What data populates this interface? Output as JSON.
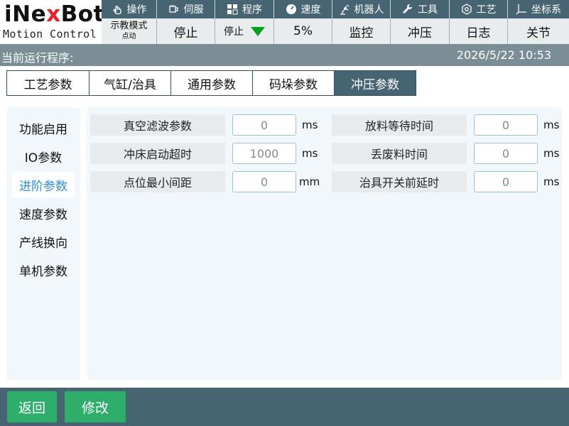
{
  "logo": {
    "brand": [
      "i",
      "Ne",
      "x",
      "Bot"
    ],
    "tagline": "Motion Control"
  },
  "topnav": [
    {
      "label": "操作",
      "icon": "hand-pointer-icon"
    },
    {
      "label": "伺服",
      "icon": "servo-motor-icon"
    },
    {
      "label": "程序",
      "icon": "program-grid-icon"
    },
    {
      "label": "速度",
      "icon": "speedometer-icon"
    },
    {
      "label": "机器人",
      "icon": "robot-arm-icon"
    },
    {
      "label": "工具",
      "icon": "wrench-icon"
    },
    {
      "label": "工艺",
      "icon": "process-gear-icon"
    },
    {
      "label": "坐标系",
      "icon": "coordinate-axes-icon"
    }
  ],
  "status": {
    "mode_line1": "示教模式",
    "mode_line2": "点动",
    "run_state": "停止",
    "stop_select": "停止",
    "speed": "5%",
    "monitor": "监控",
    "stamping": "冲压",
    "log": "日志",
    "joint": "关节",
    "accent_green": "#0e9c1f"
  },
  "info": {
    "current_program_label": "当前运行程序:",
    "datetime": "2026/5/22 10:53"
  },
  "tabs": [
    "工艺参数",
    "气缸/治具",
    "通用参数",
    "码垛参数",
    "冲压参数"
  ],
  "active_tab": "冲压参数",
  "sidebar": [
    "功能启用",
    "IO参数",
    "进阶参数",
    "速度参数",
    "产线换向",
    "单机参数"
  ],
  "active_sidebar": "进阶参数",
  "params_left": [
    {
      "label": "真空滤波参数",
      "value": "0",
      "unit": "ms"
    },
    {
      "label": "冲床启动超时",
      "value": "1000",
      "unit": "ms"
    },
    {
      "label": "点位最小间距",
      "value": "0",
      "unit": "mm"
    }
  ],
  "params_right": [
    {
      "label": "放料等待时间",
      "value": "0",
      "unit": "ms"
    },
    {
      "label": "丢废料时间",
      "value": "0",
      "unit": "ms"
    },
    {
      "label": "治具开关前延时",
      "value": "0",
      "unit": "ms"
    }
  ],
  "footer": {
    "back": "返回",
    "modify": "修改"
  }
}
